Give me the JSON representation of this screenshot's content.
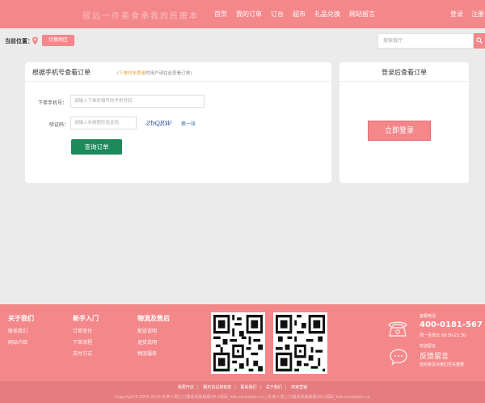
{
  "header": {
    "slogan": "很远一件美食承我的民唐本",
    "nav": [
      "首页",
      "我的订单",
      "订台",
      "超市",
      "礼品兑换",
      "网站留言"
    ],
    "login": "登录",
    "register": "注册"
  },
  "location": {
    "label": "当前位置：",
    "area_button": "切换地区"
  },
  "search": {
    "placeholder": "搜索餐厅"
  },
  "phone_query": {
    "title": "根据手机号查看订单",
    "note_open": "(",
    "note_highlight": "下单时未登录",
    "note_rest": "的用户请在此查看订单)",
    "phone_label": "下单手机号：",
    "phone_placeholder": "请输入下单时填写的手机号码",
    "captcha_label": "验证码：",
    "captcha_placeholder": "请输入右侧图形验证码",
    "captcha_text": "2bQRW",
    "refresh": "换一张",
    "submit": "查询订单"
  },
  "login_panel": {
    "title": "登录后查看订单",
    "button": "立即登录"
  },
  "footer": {
    "columns": [
      {
        "title": "关于我们",
        "links": [
          "联系我们",
          "网站介绍"
        ]
      },
      {
        "title": "新手入门",
        "links": [
          "订单支付",
          "下单流程",
          "支付方式"
        ]
      },
      {
        "title": "物流及售后",
        "links": [
          "配送说明",
          "退货说明",
          "物流服务"
        ]
      }
    ],
    "hotline_label": "客服电话",
    "hotline": "400-0181-567",
    "hours": "周一至周日 09:30-21:30",
    "feedback_label": "欢迎留言",
    "feedback_title": "反馈留言",
    "feedback_sub": "您的意见对我们至关重要"
  },
  "bottom": {
    "links": [
      "我要开店",
      "服务协议和条款",
      "联系我们",
      "关于我们",
      "商家营销"
    ],
    "copyright": "Copyright©2009-2014 外卖人网上订餐系统破解版V8.0源码_bbs.saradown.cn | 外卖人网上订餐系统破解版V8.0源码_bbs.saradown.cn"
  },
  "colors": {
    "brand": "#f4878a",
    "primary_green": "#1d8a5b",
    "link_blue": "#3b6fb5",
    "note_orange": "#e5a13b"
  },
  "icons": [
    "location-pin-icon",
    "search-icon",
    "phone-icon",
    "chat-bubble-icon",
    "qr-code-icon"
  ]
}
